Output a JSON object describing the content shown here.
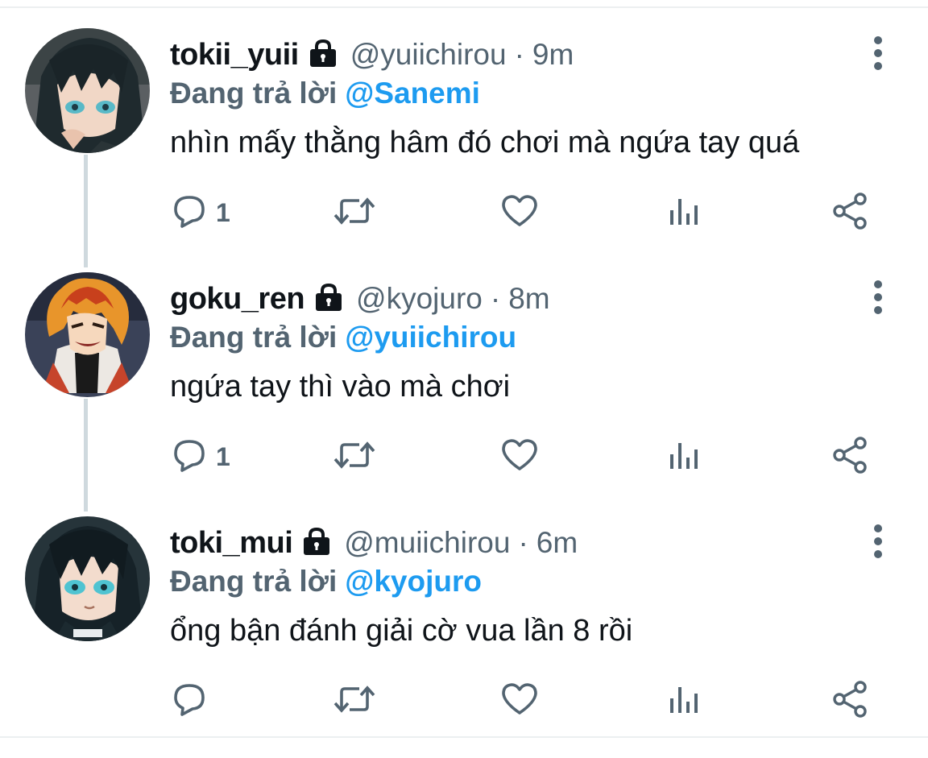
{
  "tweets": [
    {
      "display_name": "tokii_yuii",
      "handle": "@yuiichirou",
      "separator": "·",
      "time": "9m",
      "replying_label": "Đang trả lời",
      "replying_to": "@Sanemi",
      "text": "nhìn mấy thằng hâm đó chơi mà ngứa tay quá",
      "reply_count": "1"
    },
    {
      "display_name": "goku_ren",
      "handle": "@kyojuro",
      "separator": "·",
      "time": "8m",
      "replying_label": "Đang trả lời",
      "replying_to": "@yuiichirou",
      "text": "ngứa tay thì vào mà chơi",
      "reply_count": "1"
    },
    {
      "display_name": "toki_mui",
      "handle": "@muiichirou",
      "separator": "·",
      "time": "6m",
      "replying_label": "Đang trả lời",
      "replying_to": "@kyojuro",
      "text": "ổng bận đánh giải cờ vua lần 8 rồi",
      "reply_count": ""
    }
  ],
  "icons": {
    "protected": "lock-icon",
    "more": "more-vertical-icon",
    "reply": "reply-icon",
    "retweet": "retweet-icon",
    "like": "heart-icon",
    "views": "views-icon",
    "share": "share-icon"
  },
  "colors": {
    "text_primary": "#0f1419",
    "text_secondary": "#536471",
    "mention": "#1d9bf0",
    "thread_line": "#cfd9de"
  }
}
